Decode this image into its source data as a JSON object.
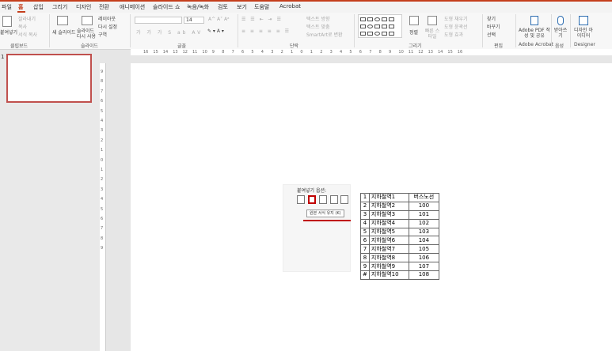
{
  "tabs": [
    "파일",
    "홈",
    "삽입",
    "그리기",
    "디자인",
    "전환",
    "애니메이션",
    "슬라이드 쇼",
    "녹음/녹화",
    "검토",
    "보기",
    "도움말",
    "Acrobat"
  ],
  "ribbon": {
    "clipboard": {
      "paste_label": "붙여넣기",
      "cut": "잘라내기",
      "copy": "복사",
      "format_painter": "서식 복사",
      "group": "클립보드"
    },
    "slides": {
      "new_slide": "새 슬라이드",
      "reuse_slide": "슬라이드 다시 사용",
      "layout": "레이아웃",
      "reset": "다시 설정",
      "section": "구역",
      "group": "슬라이드"
    },
    "font": {
      "group": "글꼴",
      "size": "14"
    },
    "paragraph": {
      "text_direction": "텍스트 방향",
      "align_text": "텍스트 맞춤",
      "smartart": "SmartArt로 변환",
      "group": "단락"
    },
    "drawing": {
      "arrange": "정렬",
      "quick_styles": "빠른 스타일",
      "shape_fill": "도형 채우기",
      "shape_outline": "도형 윤곽선",
      "shape_effects": "도형 효과",
      "group": "그리기"
    },
    "editing": {
      "find": "찾기",
      "replace": "바꾸기",
      "select": "선택",
      "group": "편집"
    },
    "acrobat": {
      "create_pdf": "Adobe PDF 작성 및 공유",
      "group": "Adobe Acrobat"
    },
    "voice": {
      "dictate": "받아쓰기",
      "group": "음성"
    },
    "designer": {
      "ideas": "디자인 아이디어",
      "group": "Designer"
    }
  },
  "ruler_h": [
    "16",
    "15",
    "14",
    "13",
    "12",
    "11",
    "10",
    "9",
    "8",
    "7",
    "6",
    "5",
    "4",
    "3",
    "2",
    "1",
    "0",
    "1",
    "2",
    "3",
    "4",
    "5",
    "6",
    "7",
    "8",
    "9",
    "10",
    "11",
    "12",
    "13",
    "14",
    "15",
    "16"
  ],
  "ruler_v": [
    "9",
    "8",
    "7",
    "6",
    "5",
    "4",
    "3",
    "2",
    "1",
    "0",
    "1",
    "2",
    "3",
    "4",
    "5",
    "6",
    "7",
    "8",
    "9"
  ],
  "slide_panel": {
    "slide_number": "1"
  },
  "paste_options": {
    "title": "붙여넣기 옵션:",
    "tooltip": "원본 서식 유지 (K)"
  },
  "table": {
    "header": [
      "1",
      "지하철역1",
      "버스노선"
    ],
    "rows": [
      [
        "2",
        "지하철역2",
        "100"
      ],
      [
        "3",
        "지하철역3",
        "101"
      ],
      [
        "4",
        "지하철역4",
        "102"
      ],
      [
        "5",
        "지하철역5",
        "103"
      ],
      [
        "6",
        "지하철역6",
        "104"
      ],
      [
        "7",
        "지하철역7",
        "105"
      ],
      [
        "8",
        "지하철역8",
        "106"
      ],
      [
        "9",
        "지하철역9",
        "107"
      ],
      [
        "#",
        "지하철역10",
        "108"
      ]
    ]
  }
}
